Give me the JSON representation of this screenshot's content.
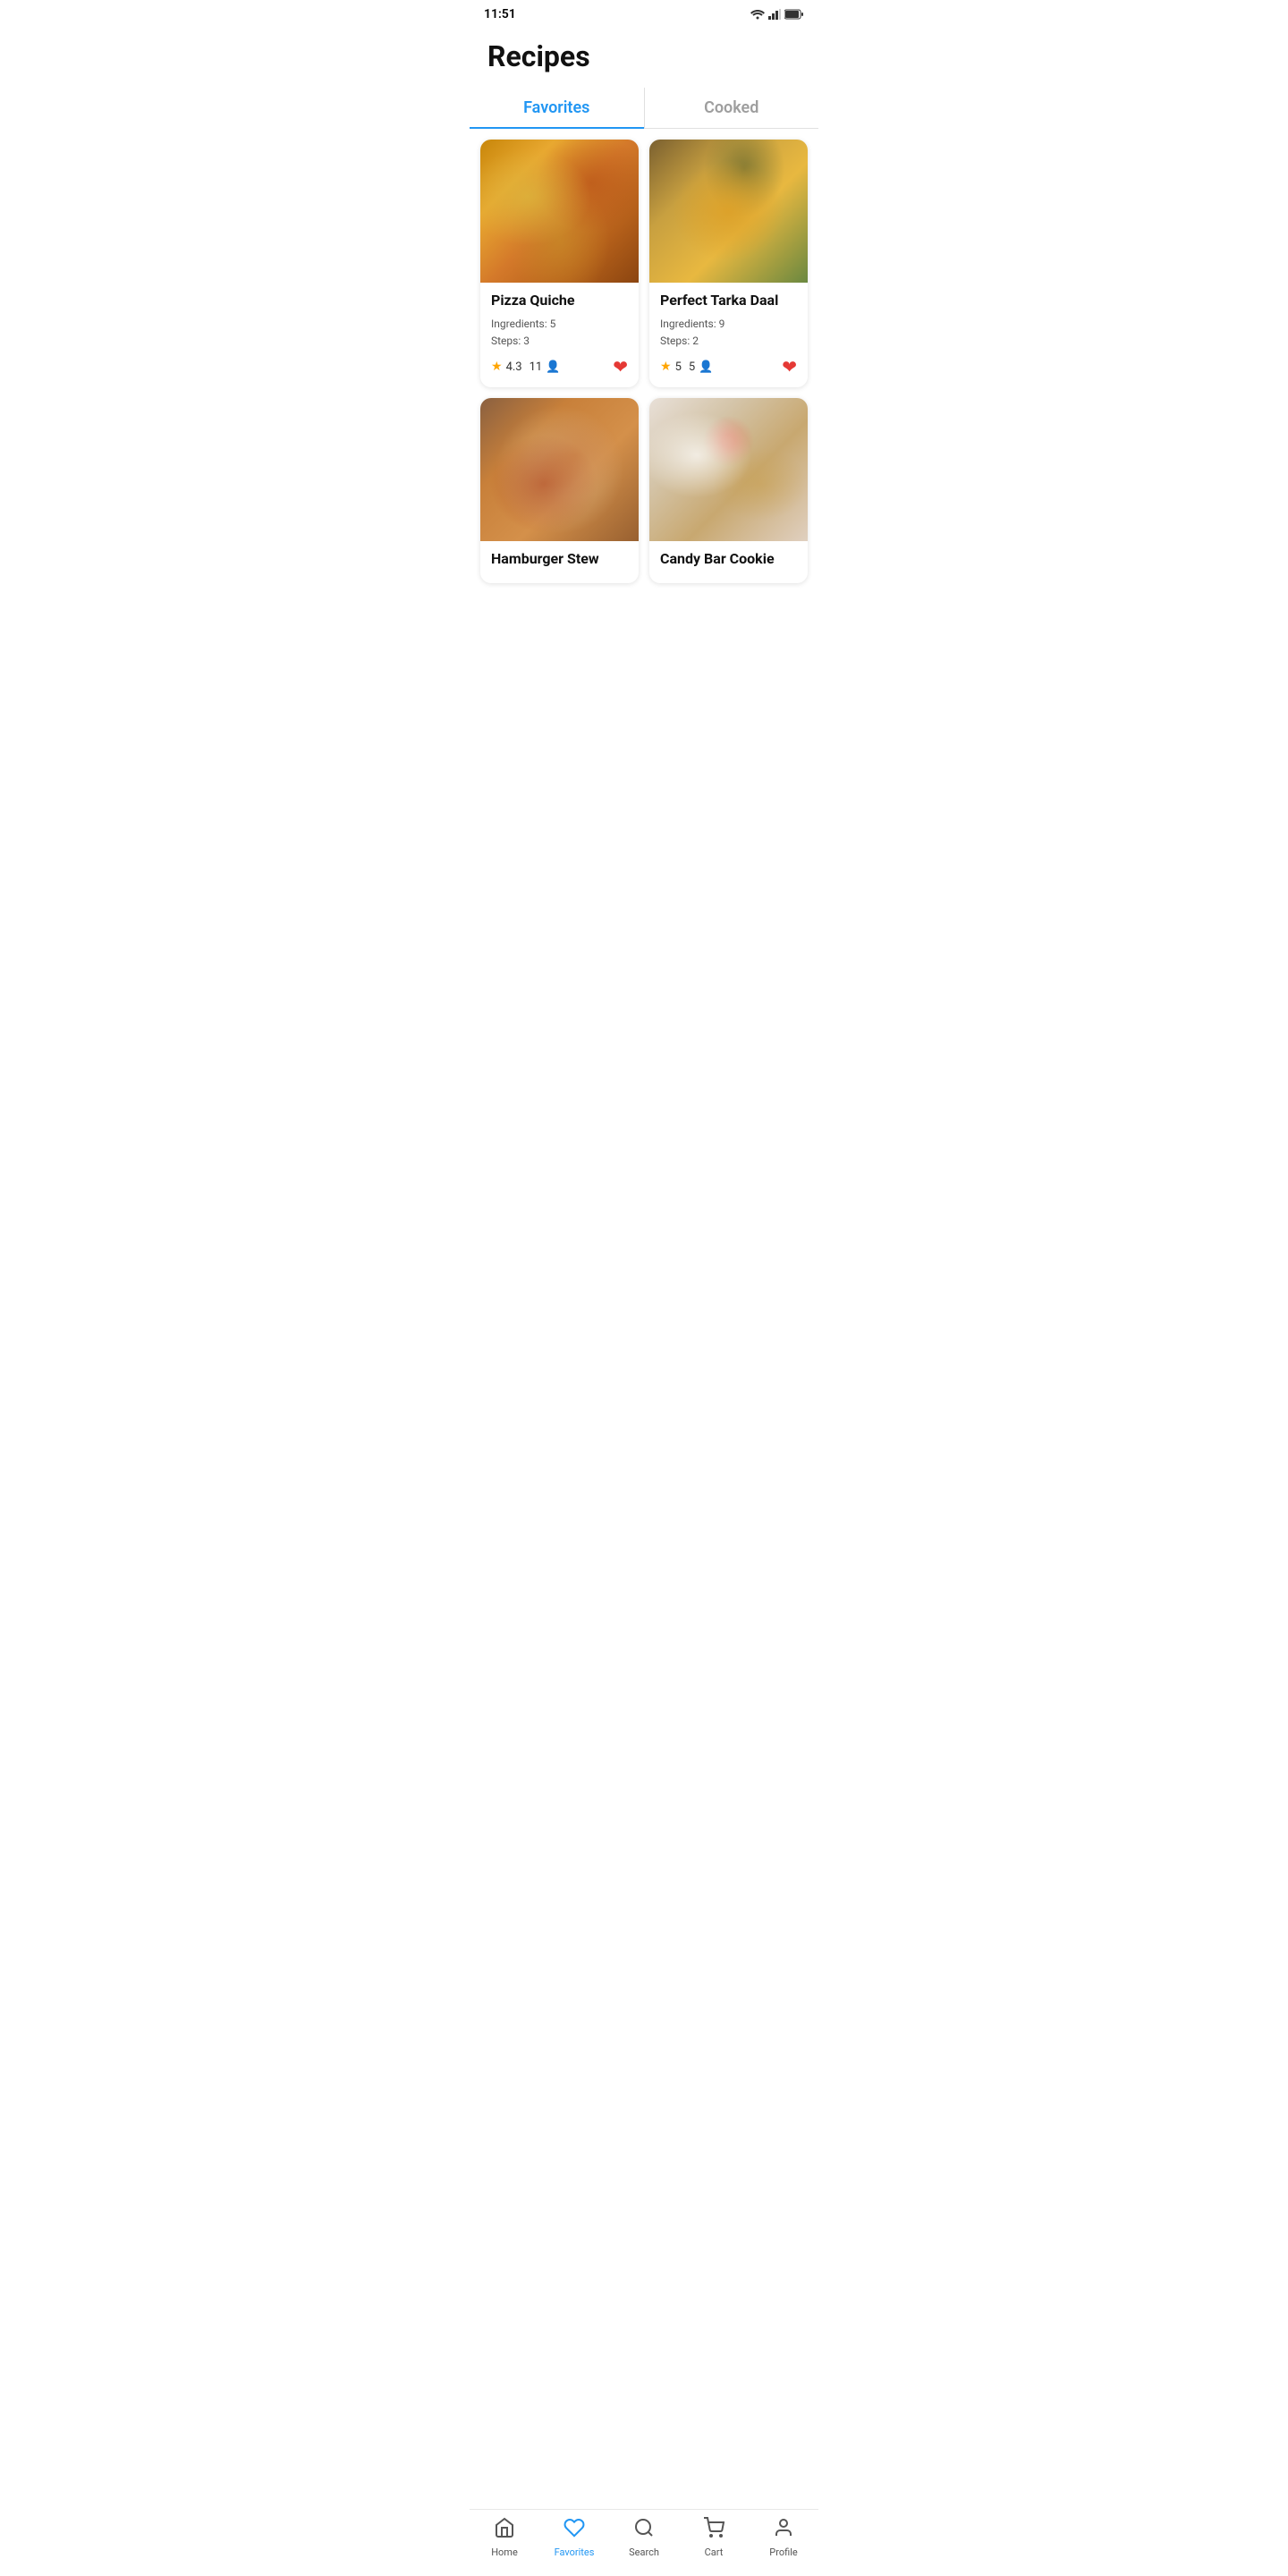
{
  "statusBar": {
    "time": "11:51"
  },
  "header": {
    "title": "Recipes"
  },
  "tabs": [
    {
      "id": "favorites",
      "label": "Favorites",
      "active": true
    },
    {
      "id": "cooked",
      "label": "Cooked",
      "active": false
    }
  ],
  "recipes": [
    {
      "id": "pizza-quiche",
      "title": "Pizza Quiche",
      "ingredients": "Ingredients: 5",
      "steps": "Steps: 3",
      "rating": "4.3",
      "ratingCount": "11",
      "imageClass": "img-pizza",
      "favorited": true
    },
    {
      "id": "tarka-daal",
      "title": "Perfect Tarka Daal",
      "ingredients": "Ingredients: 9",
      "steps": "Steps: 2",
      "rating": "5",
      "ratingCount": "5",
      "imageClass": "img-daal",
      "favorited": true
    },
    {
      "id": "hamburger-stew",
      "title": "Hamburger Stew",
      "ingredients": "",
      "steps": "",
      "rating": "",
      "ratingCount": "",
      "imageClass": "img-stew",
      "favorited": false
    },
    {
      "id": "candy-bar-cookie",
      "title": "Candy Bar Cookie",
      "ingredients": "",
      "steps": "",
      "rating": "",
      "ratingCount": "",
      "imageClass": "img-cookie",
      "favorited": false
    }
  ],
  "bottomNav": [
    {
      "id": "home",
      "label": "Home",
      "icon": "⌂",
      "active": false
    },
    {
      "id": "favorites",
      "label": "Favorites",
      "icon": "♡",
      "active": true
    },
    {
      "id": "search",
      "label": "Search",
      "icon": "⌕",
      "active": false
    },
    {
      "id": "cart",
      "label": "Cart",
      "icon": "🛒",
      "active": false
    },
    {
      "id": "profile",
      "label": "Profile",
      "icon": "👤",
      "active": false
    }
  ],
  "colors": {
    "activeBlue": "#2196f3",
    "heartRed": "#e53935",
    "starOrange": "#FFA500"
  }
}
